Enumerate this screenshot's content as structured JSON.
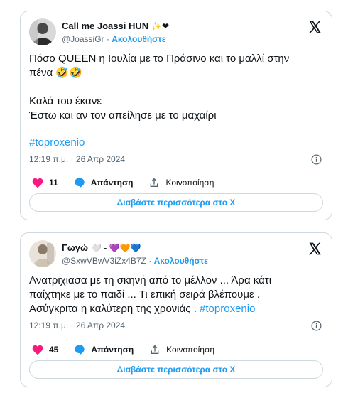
{
  "tweets": [
    {
      "display_name": "Call me Joassi HUN",
      "name_emojis": "✨❤",
      "handle": "@JoassiGr",
      "separator": "·",
      "follow_label": "Ακολουθήστε",
      "line1": "Πόσο QUEEN η Ιουλία με το Πράσινο και το μαλλί στην",
      "line2": "πένα 🤣🤣",
      "line3": "Καλά του έκανε",
      "line4": "Έστω και αν τον απείλησε με το μαχαίρι",
      "hashtag": "#toproxenio",
      "timestamp": "12:19 π.μ. · 26 Απρ 2024",
      "likes": "11",
      "reply_label": "Απάντηση",
      "share_label": "Κοινοποίηση",
      "read_more_label": "Διαβάστε περισσότερα στο Χ"
    },
    {
      "display_name": "Γωγώ",
      "name_emojis": "🤍 - 💜🧡💙",
      "handle": "@SxwVBwV3iZx4B7Z",
      "separator": "·",
      "follow_label": "Ακολουθήστε",
      "line1": "Ανατριχιασα με τη σκηνή από το μέλλον ... Άρα κάτι",
      "line2": "παίχτηκε με το παιδί ... Τι επική σειρά βλέπουμε .",
      "line3": "Ασύγκριτα η καλύτερη της χρονιάς .",
      "hashtag": "#toproxenio",
      "timestamp": "12:19 π.μ. · 26 Απρ 2024",
      "likes": "45",
      "reply_label": "Απάντηση",
      "share_label": "Κοινοποίηση",
      "read_more_label": "Διαβάστε περισσότερα στο Χ"
    }
  ],
  "colors": {
    "accent": "#1d9bf0",
    "like": "#f91880",
    "text": "#0f1419",
    "muted": "#536471",
    "border": "#cfd9de"
  },
  "icons": [
    "x-logo-icon",
    "info-icon",
    "heart-icon",
    "reply-bubble-icon",
    "share-icon"
  ]
}
